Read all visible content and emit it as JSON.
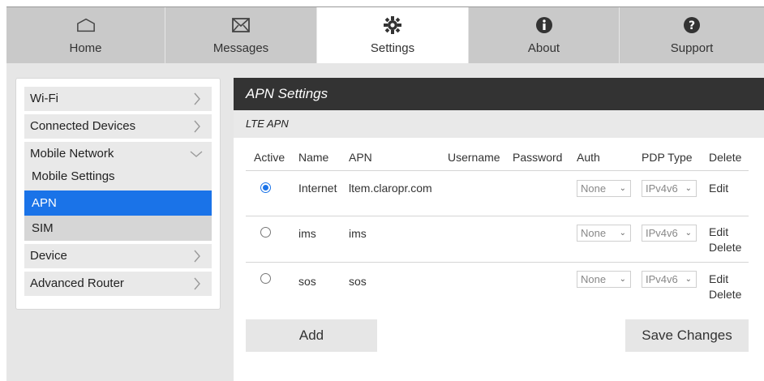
{
  "nav": {
    "tabs": [
      {
        "label": "Home",
        "icon": "home-icon",
        "active": false
      },
      {
        "label": "Messages",
        "icon": "envelope-icon",
        "active": false
      },
      {
        "label": "Settings",
        "icon": "gear-icon",
        "active": true
      },
      {
        "label": "About",
        "icon": "info-icon",
        "active": false
      },
      {
        "label": "Support",
        "icon": "help-icon",
        "active": false
      }
    ]
  },
  "sidebar": {
    "wifi": "Wi-Fi",
    "connected_devices": "Connected Devices",
    "mobile_network": "Mobile Network",
    "mobile_settings": "Mobile Settings",
    "apn": "APN",
    "sim": "SIM",
    "device": "Device",
    "advanced_router": "Advanced Router"
  },
  "panel": {
    "title": "APN Settings",
    "subtitle": "LTE APN",
    "columns": [
      "Active",
      "Name",
      "APN",
      "Username",
      "Password",
      "Auth",
      "PDP Type",
      "Delete"
    ],
    "rows": [
      {
        "active": true,
        "name": "Internet",
        "apn": "ltem.claropr.com",
        "username": "",
        "password": "",
        "auth": "None",
        "pdp": "IPv4v6",
        "action1": "Edit",
        "action2": ""
      },
      {
        "active": false,
        "name": "ims",
        "apn": "ims",
        "username": "",
        "password": "",
        "auth": "None",
        "pdp": "IPv4v6",
        "action1": "Edit",
        "action2": "Delete"
      },
      {
        "active": false,
        "name": "sos",
        "apn": "sos",
        "username": "",
        "password": "",
        "auth": "None",
        "pdp": "IPv4v6",
        "action1": "Edit",
        "action2": "Delete"
      }
    ],
    "add_label": "Add",
    "save_label": "Save Changes"
  },
  "colors": {
    "accent": "#1a73e8",
    "header_dark": "#333333",
    "nav_bg": "#c9c9c9"
  }
}
